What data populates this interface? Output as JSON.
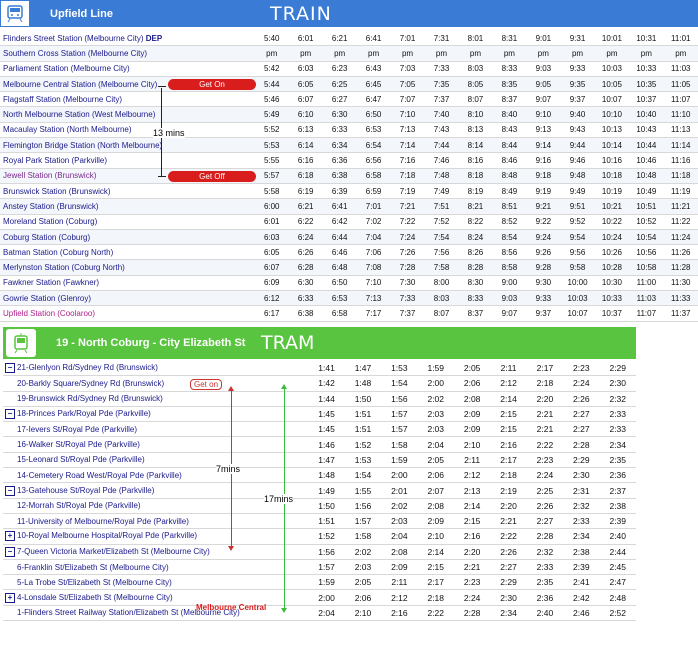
{
  "train": {
    "line_name": "Upfield Line",
    "banner": "TRAIN",
    "dep_label": "DEP",
    "rows": [
      {
        "station": "Flinders Street Station (Melbourne City)",
        "times": [
          "5:40",
          "6:01",
          "6:21",
          "6:41",
          "7:01",
          "7:31",
          "8:01",
          "8:31",
          "9:01",
          "9:31",
          "10:01",
          "10:31",
          "11:01"
        ]
      },
      {
        "station": "Southern Cross Station (Melbourne City)",
        "times": [
          "pm",
          "pm",
          "pm",
          "pm",
          "pm",
          "pm",
          "pm",
          "pm",
          "pm",
          "pm",
          "pm",
          "pm",
          "pm"
        ]
      },
      {
        "station": "Parliament Station (Melbourne City)",
        "times": [
          "5:42",
          "6:03",
          "6:23",
          "6:43",
          "7:03",
          "7:33",
          "8:03",
          "8:33",
          "9:03",
          "9:33",
          "10:03",
          "10:33",
          "11:03"
        ]
      },
      {
        "station": "Melbourne Central Station (Melbourne City)",
        "times": [
          "5:44",
          "6:05",
          "6:25",
          "6:45",
          "7:05",
          "7:35",
          "8:05",
          "8:35",
          "9:05",
          "9:35",
          "10:05",
          "10:35",
          "11:05"
        ]
      },
      {
        "station": "Flagstaff Station (Melbourne City)",
        "times": [
          "5:46",
          "6:07",
          "6:27",
          "6:47",
          "7:07",
          "7:37",
          "8:07",
          "8:37",
          "9:07",
          "9:37",
          "10:07",
          "10:37",
          "11:07"
        ]
      },
      {
        "station": "North Melbourne Station (West Melbourne)",
        "times": [
          "5:49",
          "6:10",
          "6:30",
          "6:50",
          "7:10",
          "7:40",
          "8:10",
          "8:40",
          "9:10",
          "9:40",
          "10:10",
          "10:40",
          "11:10"
        ]
      },
      {
        "station": "Macaulay Station (North Melbourne)",
        "times": [
          "5:52",
          "6:13",
          "6:33",
          "6:53",
          "7:13",
          "7:43",
          "8:13",
          "8:43",
          "9:13",
          "9:43",
          "10:13",
          "10:43",
          "11:13"
        ]
      },
      {
        "station": "Flemington Bridge Station (North Melbourne)",
        "times": [
          "5:53",
          "6:14",
          "6:34",
          "6:54",
          "7:14",
          "7:44",
          "8:14",
          "8:44",
          "9:14",
          "9:44",
          "10:14",
          "10:44",
          "11:14"
        ]
      },
      {
        "station": "Royal Park Station (Parkville)",
        "times": [
          "5:55",
          "6:16",
          "6:36",
          "6:56",
          "7:16",
          "7:46",
          "8:16",
          "8:46",
          "9:16",
          "9:46",
          "10:16",
          "10:46",
          "11:16"
        ]
      },
      {
        "station": "Jewell Station (Brunswick)",
        "times": [
          "5:57",
          "6:18",
          "6:38",
          "6:58",
          "7:18",
          "7:48",
          "8:18",
          "8:48",
          "9:18",
          "9:48",
          "10:18",
          "10:48",
          "11:18"
        ]
      },
      {
        "station": "Brunswick Station (Brunswick)",
        "times": [
          "5:58",
          "6:19",
          "6:39",
          "6:59",
          "7:19",
          "7:49",
          "8:19",
          "8:49",
          "9:19",
          "9:49",
          "10:19",
          "10:49",
          "11:19"
        ]
      },
      {
        "station": "Anstey Station (Brunswick)",
        "times": [
          "6:00",
          "6:21",
          "6:41",
          "7:01",
          "7:21",
          "7:51",
          "8:21",
          "8:51",
          "9:21",
          "9:51",
          "10:21",
          "10:51",
          "11:21"
        ]
      },
      {
        "station": "Moreland Station (Coburg)",
        "times": [
          "6:01",
          "6:22",
          "6:42",
          "7:02",
          "7:22",
          "7:52",
          "8:22",
          "8:52",
          "9:22",
          "9:52",
          "10:22",
          "10:52",
          "11:22"
        ]
      },
      {
        "station": "Coburg Station (Coburg)",
        "times": [
          "6:03",
          "6:24",
          "6:44",
          "7:04",
          "7:24",
          "7:54",
          "8:24",
          "8:54",
          "9:24",
          "9:54",
          "10:24",
          "10:54",
          "11:24"
        ]
      },
      {
        "station": "Batman Station (Coburg North)",
        "times": [
          "6:05",
          "6:26",
          "6:46",
          "7:06",
          "7:26",
          "7:56",
          "8:26",
          "8:56",
          "9:26",
          "9:56",
          "10:26",
          "10:56",
          "11:26"
        ]
      },
      {
        "station": "Merlynston Station (Coburg North)",
        "times": [
          "6:07",
          "6:28",
          "6:48",
          "7:08",
          "7:28",
          "7:58",
          "8:28",
          "8:58",
          "9:28",
          "9:58",
          "10:28",
          "10:58",
          "11:28"
        ]
      },
      {
        "station": "Fawkner Station (Fawkner)",
        "times": [
          "6:09",
          "6:30",
          "6:50",
          "7:10",
          "7:30",
          "8:00",
          "8:30",
          "9:00",
          "9:30",
          "10:00",
          "10:30",
          "11:00",
          "11:30"
        ]
      },
      {
        "station": "Gowrie Station (Glenroy)",
        "times": [
          "6:12",
          "6:33",
          "6:53",
          "7:13",
          "7:33",
          "8:03",
          "8:33",
          "9:03",
          "9:33",
          "10:03",
          "10:33",
          "11:03",
          "11:33"
        ]
      },
      {
        "station": "Upfield Station (Coolaroo)",
        "times": [
          "6:17",
          "6:38",
          "6:58",
          "7:17",
          "7:37",
          "8:07",
          "8:37",
          "9:07",
          "9:37",
          "10:07",
          "10:37",
          "11:07",
          "11:37"
        ]
      }
    ],
    "annotations": {
      "get_on": "Get On",
      "get_off": "Get Off",
      "duration": "13 mins"
    }
  },
  "tram": {
    "route": "19 - North Coburg - City Elizabeth St",
    "banner": "TRAM",
    "rows": [
      {
        "marker": "minus",
        "station": "21-Glenlyon Rd/Sydney Rd (Brunswick)",
        "times": [
          "1:41",
          "1:47",
          "1:53",
          "1:59",
          "2:05",
          "2:11",
          "2:17",
          "2:23",
          "2:29"
        ]
      },
      {
        "marker": "",
        "station": "20-Barkly Square/Sydney Rd (Brunswick)",
        "times": [
          "1:42",
          "1:48",
          "1:54",
          "2:00",
          "2:06",
          "2:12",
          "2:18",
          "2:24",
          "2:30"
        ]
      },
      {
        "marker": "",
        "station": "19-Brunswick Rd/Sydney Rd (Brunswick)",
        "times": [
          "1:44",
          "1:50",
          "1:56",
          "2:02",
          "2:08",
          "2:14",
          "2:20",
          "2:26",
          "2:32"
        ]
      },
      {
        "marker": "minus",
        "station": "18-Princes Park/Royal Pde (Parkville)",
        "times": [
          "1:45",
          "1:51",
          "1:57",
          "2:03",
          "2:09",
          "2:15",
          "2:21",
          "2:27",
          "2:33"
        ]
      },
      {
        "marker": "",
        "station": "17-Ievers St/Royal Pde (Parkville)",
        "times": [
          "1:45",
          "1:51",
          "1:57",
          "2:03",
          "2:09",
          "2:15",
          "2:21",
          "2:27",
          "2:33"
        ]
      },
      {
        "marker": "",
        "station": "16-Walker St/Royal Pde (Parkville)",
        "times": [
          "1:46",
          "1:52",
          "1:58",
          "2:04",
          "2:10",
          "2:16",
          "2:22",
          "2:28",
          "2:34"
        ]
      },
      {
        "marker": "",
        "station": "15-Leonard St/Royal Pde (Parkville)",
        "times": [
          "1:47",
          "1:53",
          "1:59",
          "2:05",
          "2:11",
          "2:17",
          "2:23",
          "2:29",
          "2:35"
        ]
      },
      {
        "marker": "",
        "station": "14-Cemetery Road West/Royal Pde (Parkville)",
        "times": [
          "1:48",
          "1:54",
          "2:00",
          "2:06",
          "2:12",
          "2:18",
          "2:24",
          "2:30",
          "2:36"
        ]
      },
      {
        "marker": "minus",
        "station": "13-Gatehouse St/Royal Pde (Parkville)",
        "times": [
          "1:49",
          "1:55",
          "2:01",
          "2:07",
          "2:13",
          "2:19",
          "2:25",
          "2:31",
          "2:37"
        ]
      },
      {
        "marker": "",
        "station": "12-Morrah St/Royal Pde (Parkville)",
        "times": [
          "1:50",
          "1:56",
          "2:02",
          "2:08",
          "2:14",
          "2:20",
          "2:26",
          "2:32",
          "2:38"
        ]
      },
      {
        "marker": "",
        "station": "11-University of Melbourne/Royal Pde (Parkville)",
        "times": [
          "1:51",
          "1:57",
          "2:03",
          "2:09",
          "2:15",
          "2:21",
          "2:27",
          "2:33",
          "2:39"
        ]
      },
      {
        "marker": "plus",
        "station": "10-Royal Melbourne Hospital/Royal Pde (Parkville)",
        "times": [
          "1:52",
          "1:58",
          "2:04",
          "2:10",
          "2:16",
          "2:22",
          "2:28",
          "2:34",
          "2:40"
        ]
      },
      {
        "marker": "minus",
        "station": "7-Queen Victoria Market/Elizabeth St (Melbourne City)",
        "times": [
          "1:56",
          "2:02",
          "2:08",
          "2:14",
          "2:20",
          "2:26",
          "2:32",
          "2:38",
          "2:44"
        ]
      },
      {
        "marker": "",
        "station": "6-Franklin St/Elizabeth St (Melbourne City)",
        "times": [
          "1:57",
          "2:03",
          "2:09",
          "2:15",
          "2:21",
          "2:27",
          "2:33",
          "2:39",
          "2:45"
        ]
      },
      {
        "marker": "",
        "station": "5-La Trobe St/Elizabeth St (Melbourne City)",
        "times": [
          "1:59",
          "2:05",
          "2:11",
          "2:17",
          "2:23",
          "2:29",
          "2:35",
          "2:41",
          "2:47"
        ]
      },
      {
        "marker": "plus",
        "station": "4-Lonsdale St/Elizabeth St (Melbourne City)",
        "times": [
          "2:00",
          "2:06",
          "2:12",
          "2:18",
          "2:24",
          "2:30",
          "2:36",
          "2:42",
          "2:48"
        ]
      },
      {
        "marker": "",
        "station": "1-Flinders Street Railway Station/Elizabeth St (Melbourne City)",
        "times": [
          "2:04",
          "2:10",
          "2:16",
          "2:22",
          "2:28",
          "2:34",
          "2:40",
          "2:46",
          "2:52"
        ]
      }
    ],
    "annotations": {
      "get_on": "Get on",
      "melbourne_central": "Melbourne Central",
      "seven": "7mins",
      "seventeen": "17mins"
    }
  },
  "colors": {
    "train_blue": "#3a7bd5",
    "tram_green": "#58c43f",
    "badge_red": "#d91c1c"
  }
}
